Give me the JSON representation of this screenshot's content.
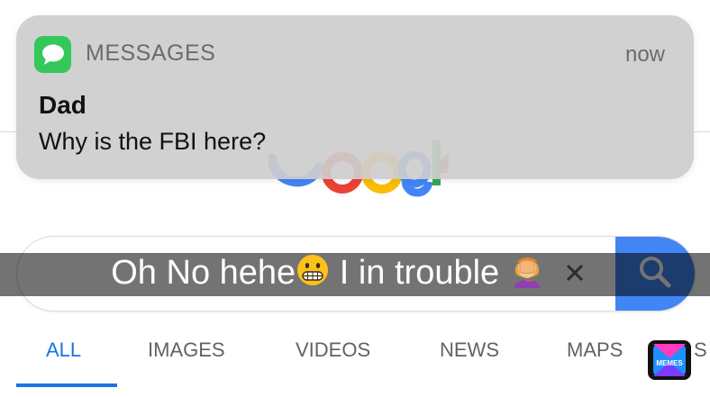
{
  "notification": {
    "app_name": "MESSAGES",
    "time": "now",
    "sender": "Dad",
    "message": "Why is the FBI here?",
    "app_icon": "messages-bubble-icon",
    "app_icon_color": "#34c759"
  },
  "google": {
    "logo_text": "Google",
    "colors": {
      "blue": "#4285f4",
      "red": "#ea4335",
      "yellow": "#fbbc05",
      "green": "#34a853"
    }
  },
  "search": {
    "button_icon": "search-icon",
    "button_color": "#4285f4"
  },
  "caption": {
    "text_before": "Oh No hehe",
    "text_middle": " I in trouble ",
    "emoji_1": "grimacing-face",
    "emoji_2": "woman-facepalming"
  },
  "tabs": [
    {
      "label": "ALL",
      "active": true
    },
    {
      "label": "IMAGES",
      "active": false
    },
    {
      "label": "VIDEOS",
      "active": false
    },
    {
      "label": "NEWS",
      "active": false
    },
    {
      "label": "MAPS",
      "active": false
    }
  ],
  "watermark": {
    "label": "MEMES"
  }
}
